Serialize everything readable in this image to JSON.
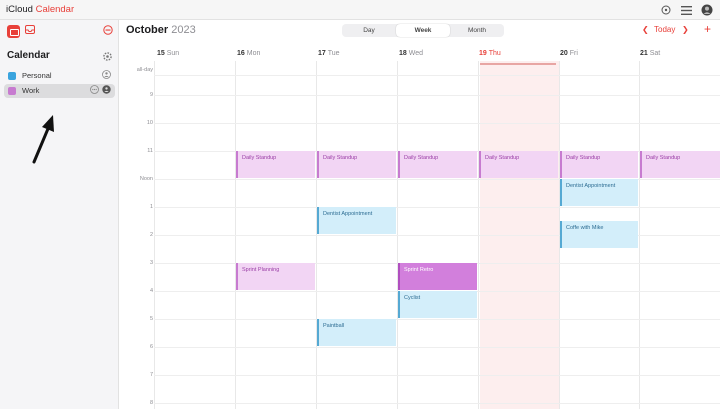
{
  "app": {
    "apple_glyph": "",
    "brand_icloud": "iCloud",
    "brand_calendar": "Calendar"
  },
  "topbar": {
    "icons": [
      "plus-circle-icon",
      "menu-icon",
      "account-icon"
    ]
  },
  "sidebar": {
    "heading": "Calendar",
    "calendars": [
      {
        "label": "Personal",
        "color": "#3aa4de",
        "selected": false
      },
      {
        "label": "Work",
        "color": "#c77bd0",
        "selected": true
      }
    ]
  },
  "header": {
    "month": "October",
    "year": "2023",
    "views": [
      "Day",
      "Week",
      "Month"
    ],
    "active_view": "Week",
    "today_label": "Today"
  },
  "days": [
    {
      "num": "15",
      "name": "Sun"
    },
    {
      "num": "16",
      "name": "Mon"
    },
    {
      "num": "17",
      "name": "Tue"
    },
    {
      "num": "18",
      "name": "Wed"
    },
    {
      "num": "19",
      "name": "Thu",
      "today": true
    },
    {
      "num": "20",
      "name": "Fri"
    },
    {
      "num": "21",
      "name": "Sat"
    }
  ],
  "all_day_label": "all-day",
  "hours": [
    "9",
    "10",
    "11",
    "Noon",
    "1",
    "2",
    "3",
    "4",
    "5",
    "6",
    "7",
    "8"
  ],
  "events": {
    "standup_mon": "Daily Standup",
    "standup_tue": "Daily Standup",
    "standup_wed": "Daily Standup",
    "standup_thu": "Daily Standup",
    "standup_fri": "Daily Standup",
    "standup_sat": "Daily Standup",
    "dentist_tue": "Dentist Appointment",
    "dentist_fri": "Dentist Appointment",
    "coffee_fri": "Coffe with Mike",
    "sprint_planning": "Sprint Planning",
    "sprint_retro": "Sprint Retro",
    "cyclist": "Cyclist",
    "paintball": "Paintball"
  },
  "colors": {
    "accent": "#e8403a",
    "work": "#c77bd0",
    "personal": "#55a9d3"
  }
}
